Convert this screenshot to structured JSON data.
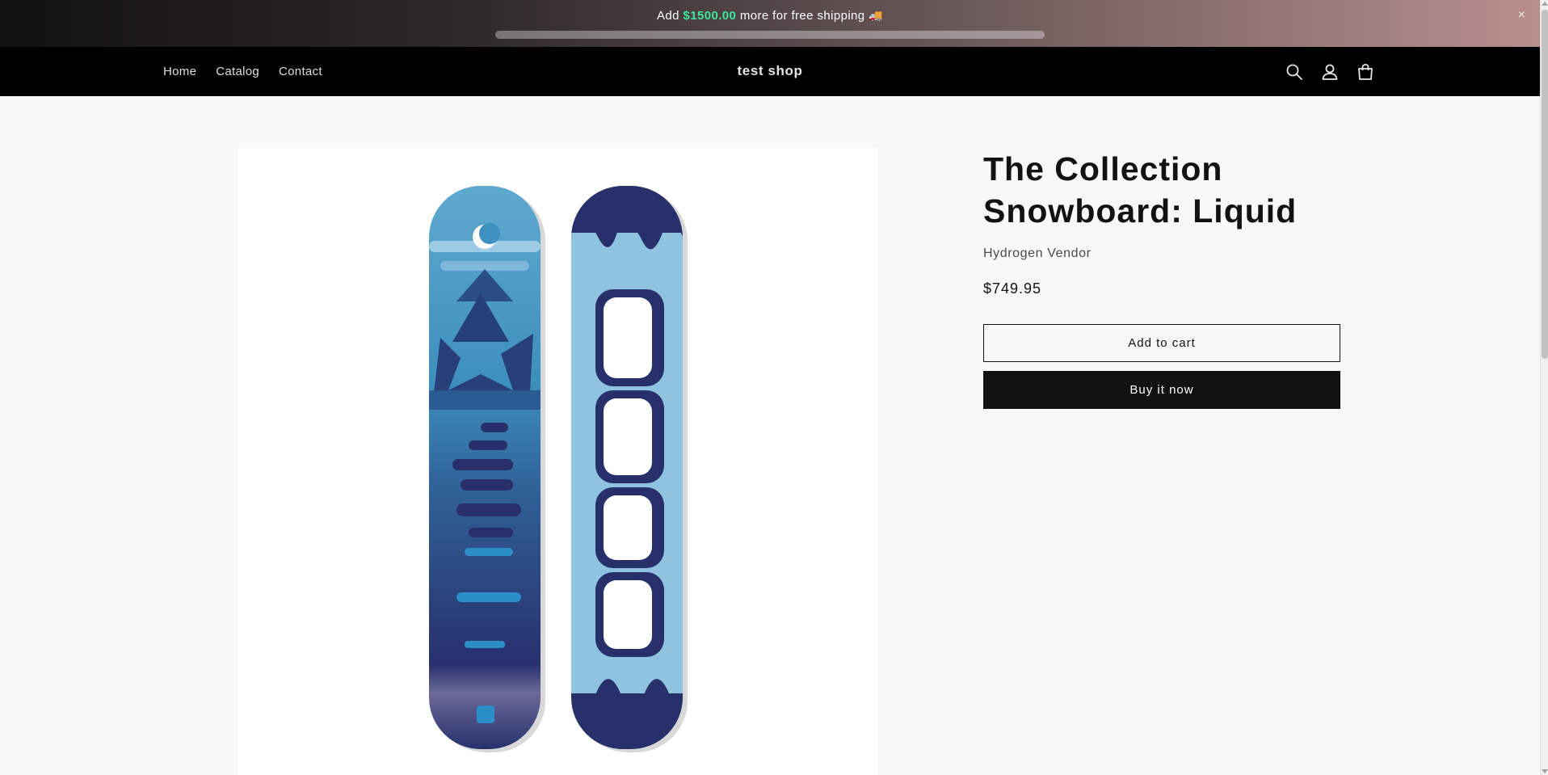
{
  "announcement": {
    "prefix": "Add",
    "amount": "$1500.00",
    "suffix": "more for free shipping",
    "emoji": "🚚",
    "progress_fraction": 0.0,
    "accent_color": "#3fe5a1",
    "close_icon": "close-icon",
    "close_glyph": "×"
  },
  "header": {
    "nav": [
      "Home",
      "Catalog",
      "Contact"
    ],
    "shop_name": "test shop",
    "icons": [
      "search-icon",
      "account-icon",
      "cart-icon"
    ]
  },
  "product": {
    "title": "The Collection Snowboard: Liquid",
    "vendor": "Hydrogen Vendor",
    "price": "$749.95",
    "add_to_cart_label": "Add to cart",
    "buy_now_label": "Buy it now",
    "image_subject": "snowboard-pair"
  },
  "colors": {
    "header_bg": "#000000",
    "button_dark": "#121212",
    "page_bg": "#f8f8f6"
  }
}
